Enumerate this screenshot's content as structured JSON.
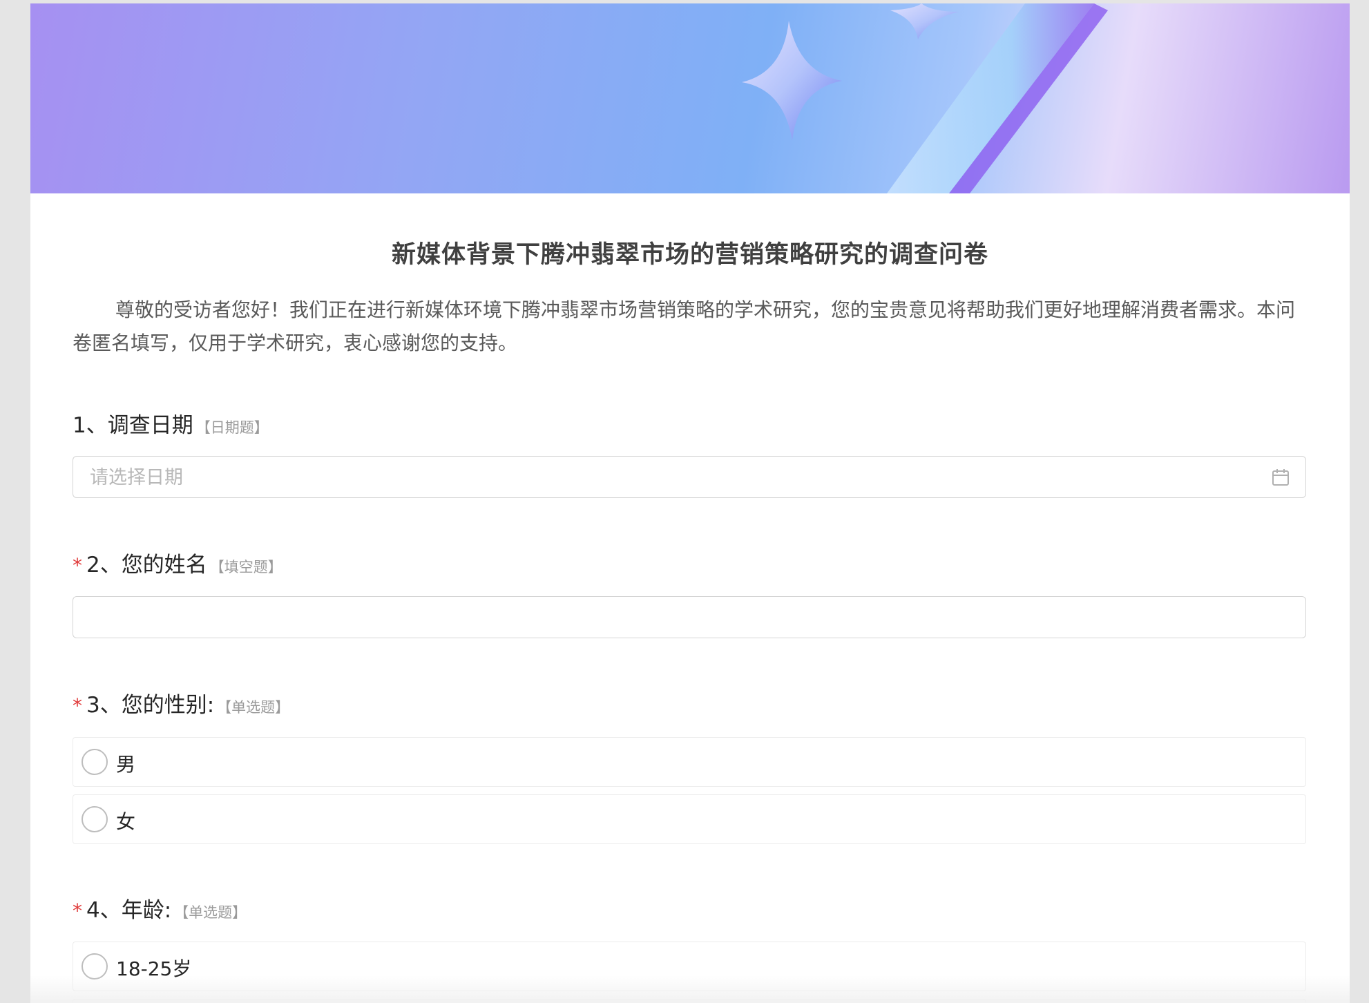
{
  "survey": {
    "title": "新媒体背景下腾冲翡翠市场的营销策略研究的调查问卷",
    "intro": "尊敬的受访者您好！我们正在进行新媒体环境下腾冲翡翠市场营销策略的学术研究，您的宝贵意见将帮助我们更好地理解消费者需求。本问卷匿名填写，仅用于学术研究，衷心感谢您的支持。"
  },
  "questions": [
    {
      "label": "1、调查日期",
      "type": "【日期题】",
      "required": false,
      "placeholder": "请选择日期",
      "icon": "calendar-icon"
    },
    {
      "label": "2、您的姓名",
      "type": "【填空题】",
      "required": true,
      "placeholder": ""
    },
    {
      "label": "3、您的性别:",
      "type": "【单选题】",
      "required": true,
      "options": [
        "男",
        "女"
      ]
    },
    {
      "label": "4、年龄:",
      "type": "【单选题】",
      "required": true,
      "options": [
        "18-25岁"
      ]
    }
  ],
  "required_mark": "*",
  "colors": {
    "required": "#e03b3b",
    "type_hint": "#9a9a9a",
    "banner_start": "#a690f2",
    "banner_end": "#b99af0"
  }
}
